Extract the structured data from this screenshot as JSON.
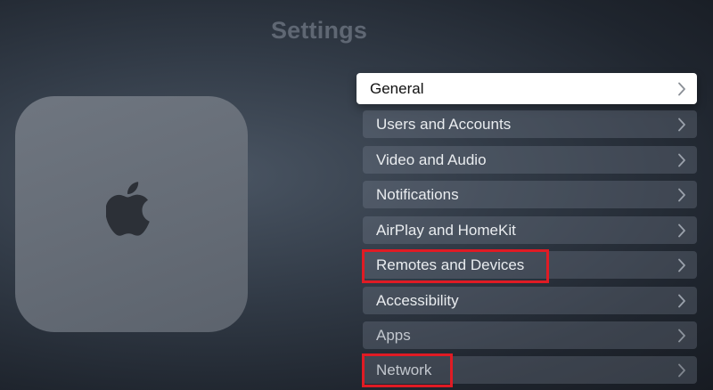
{
  "header": {
    "title": "Settings"
  },
  "device": {
    "logo_icon": "apple-logo-icon"
  },
  "menu": {
    "items": [
      {
        "label": "General",
        "icon": "chevron-right-icon",
        "focused": true
      },
      {
        "label": "Users and Accounts",
        "icon": "chevron-right-icon"
      },
      {
        "label": "Video and Audio",
        "icon": "chevron-right-icon"
      },
      {
        "label": "Notifications",
        "icon": "chevron-right-icon"
      },
      {
        "label": "AirPlay and HomeKit",
        "icon": "chevron-right-icon"
      },
      {
        "label": "Remotes and Devices",
        "icon": "chevron-right-icon",
        "highlighted": true
      },
      {
        "label": "Accessibility",
        "icon": "chevron-right-icon"
      },
      {
        "label": "Apps",
        "icon": "chevron-right-icon"
      },
      {
        "label": "Network",
        "icon": "chevron-right-icon",
        "highlighted": true
      }
    ]
  },
  "colors": {
    "highlight": "#e01b24",
    "focused_bg": "#ffffff",
    "item_bg": "#5a6270",
    "title": "#5f6773"
  }
}
